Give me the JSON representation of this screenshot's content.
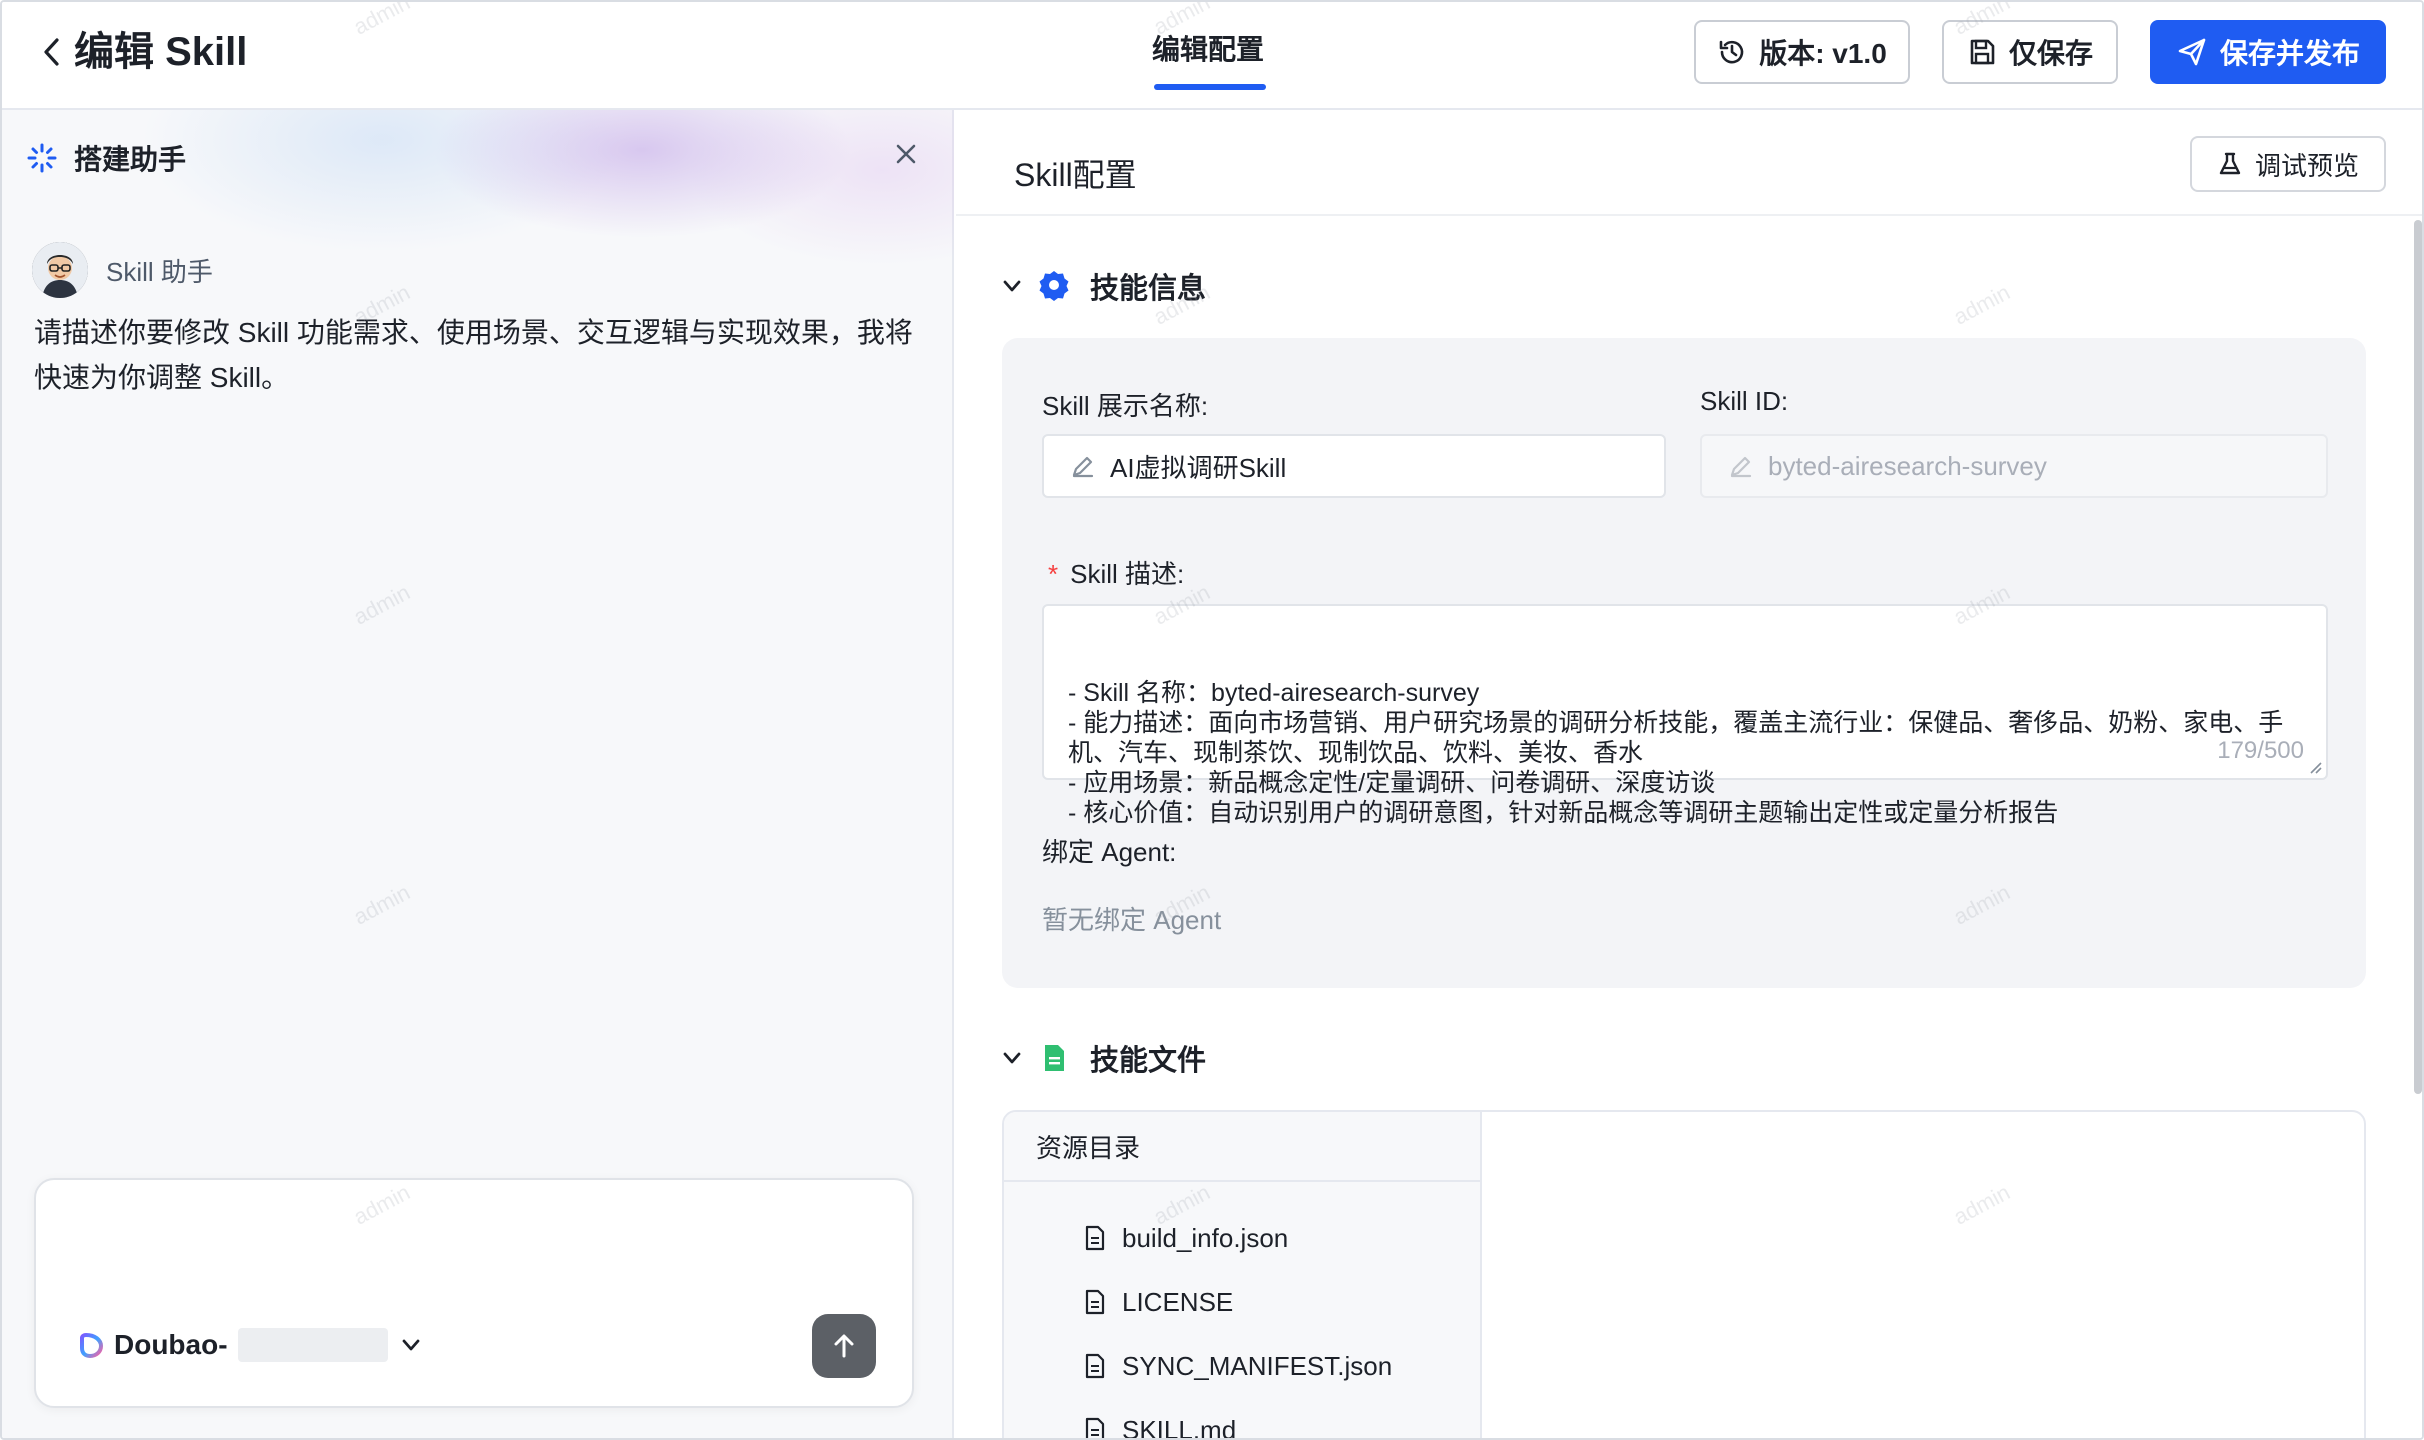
{
  "header": {
    "title": "编辑 Skill",
    "center_tab": "编辑配置",
    "version_label": "版本: v1.0",
    "save_label": "仅保存",
    "publish_label": "保存并发布"
  },
  "assistant": {
    "title": "搭建助手",
    "bot_name": "Skill 助手",
    "message": "请描述你要修改 Skill 功能需求、使用场景、交互逻辑与实现效果，我将快速为你调整 Skill。",
    "model_label": "Doubao-"
  },
  "config": {
    "title": "Skill配置",
    "preview_label": "调试预览",
    "info_section": {
      "title": "技能信息",
      "display_name_label": "Skill 展示名称:",
      "display_name_value": "AI虚拟调研Skill",
      "id_label": "Skill ID:",
      "id_value": "byted-airesearch-survey",
      "desc_label": "Skill 描述:",
      "desc_value": "- Skill 名称：byted-airesearch-survey\n- 能力描述：面向市场营销、用户研究场景的调研分析技能，覆盖主流行业：保健品、奢侈品、奶粉、家电、手机、汽车、现制茶饮、现制饮品、饮料、美妆、香水\n- 应用场景：新品概念定性/定量调研、问卷调研、深度访谈\n- 核心价值：自动识别用户的调研意图，针对新品概念等调研主题输出定性或定量分析报告",
      "desc_counter": "179/500",
      "agent_label": "绑定 Agent:",
      "agent_value": "暂无绑定 Agent"
    },
    "files_section": {
      "title": "技能文件",
      "tree_header": "资源目录",
      "files": [
        "build_info.json",
        "LICENSE",
        "SYNC_MANIFEST.json",
        "SKILL.md"
      ]
    }
  },
  "watermark": "admin",
  "colors": {
    "primary": "#1f5cf2",
    "gear_icon": "#1f5cf2",
    "doc_icon": "#2fbf71",
    "required": "#f53f3f"
  }
}
